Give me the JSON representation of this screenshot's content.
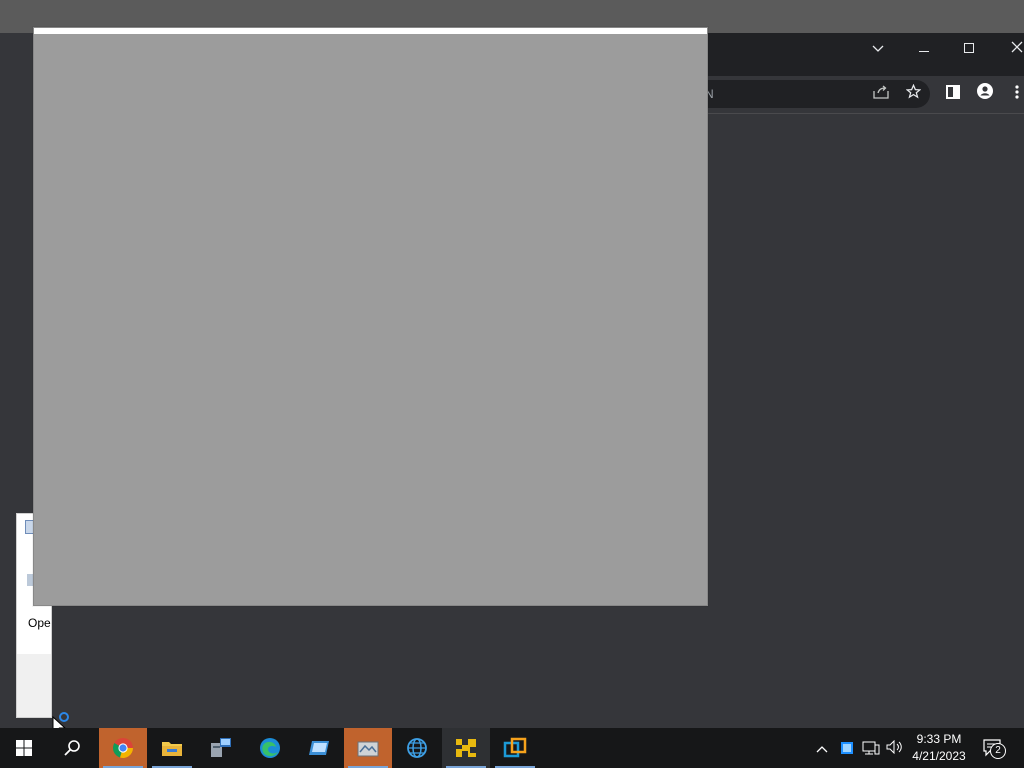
{
  "desktop": {},
  "browser": {
    "omnibox_partial_text": "N",
    "window_controls": {
      "tab_menu_icon": "chevron-down-icon",
      "minimize_icon": "minimize-icon",
      "maximize_icon": "maximize-icon",
      "close_icon": "close-icon"
    },
    "toolbar_icons": [
      "share-icon",
      "star-icon",
      "side-panel-icon",
      "profile-icon",
      "menu-icon"
    ]
  },
  "left_dialog": {
    "partial_text": "Ope"
  },
  "taskbar": {
    "apps": [
      {
        "name": "start",
        "icon": "windows-icon"
      },
      {
        "name": "search",
        "icon": "search-icon"
      },
      {
        "name": "chrome",
        "icon": "chrome-icon",
        "state": "active"
      },
      {
        "name": "file-explorer",
        "icon": "folder-icon"
      },
      {
        "name": "remote-app",
        "icon": "network-computer-icon"
      },
      {
        "name": "edge",
        "icon": "edge-icon"
      },
      {
        "name": "app-blue",
        "icon": "blue-app-icon"
      },
      {
        "name": "app-gray",
        "icon": "gray-app-icon",
        "state": "active"
      },
      {
        "name": "globe-app",
        "icon": "globe-icon"
      },
      {
        "name": "vmware-player",
        "icon": "vmware-icon",
        "state": "highlighted"
      },
      {
        "name": "vmware-workstation",
        "icon": "vmware-workstation-icon"
      }
    ],
    "tray": {
      "time": "9:33 PM",
      "date": "4/21/2023",
      "notification_count": "2"
    }
  }
}
